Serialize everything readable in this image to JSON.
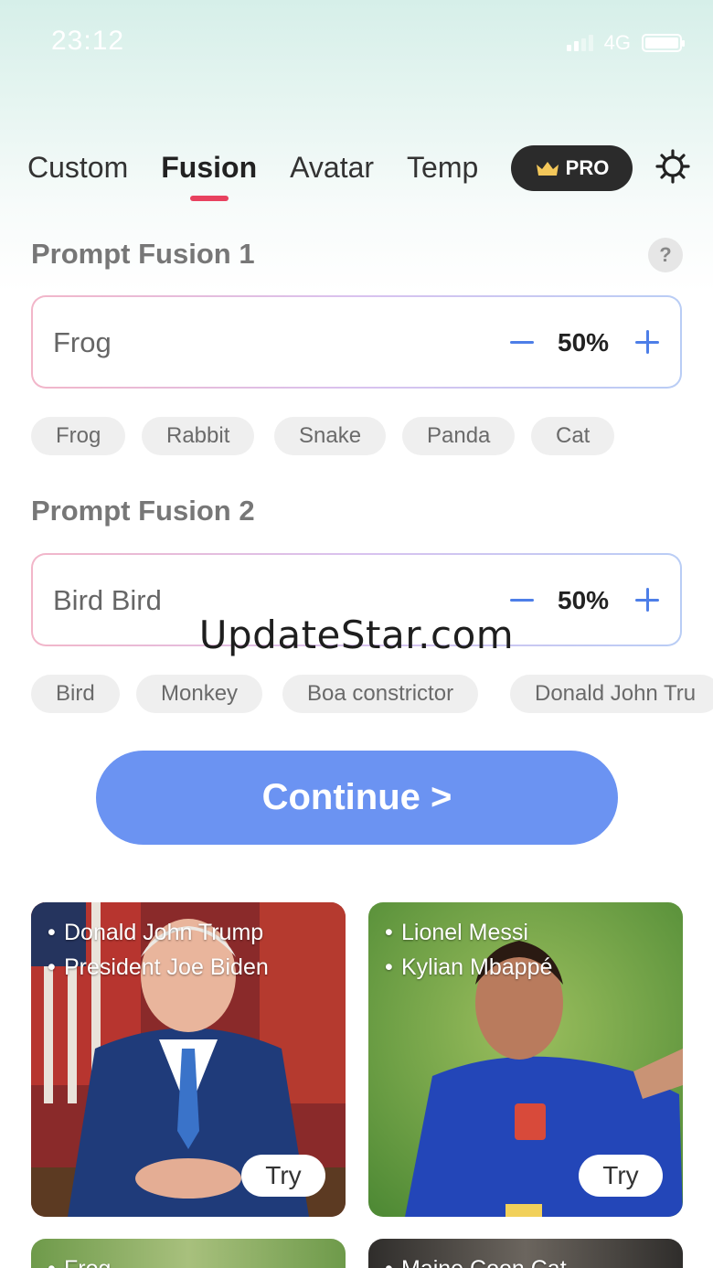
{
  "status_bar": {
    "time": "23:12",
    "network": "4G"
  },
  "tabs": [
    {
      "label": "Custom",
      "active": false
    },
    {
      "label": "Fusion",
      "active": true
    },
    {
      "label": "Avatar",
      "active": false
    },
    {
      "label": "Temp",
      "active": false
    }
  ],
  "header": {
    "pro_label": "PRO",
    "accent_color": "#e8415f"
  },
  "fusion1": {
    "title": "Prompt Fusion 1",
    "help": "?",
    "value": "Frog",
    "percent": "50%",
    "suggestions": [
      "Frog",
      "Rabbit",
      "Snake",
      "Panda",
      "Cat"
    ]
  },
  "fusion2": {
    "title": "Prompt Fusion 2",
    "value": "Bird  Bird",
    "percent": "50%",
    "suggestions": [
      "Bird",
      "Monkey",
      "Boa constrictor",
      "Donald John Tru"
    ]
  },
  "watermark": "UpdateStar.com",
  "continue_label": "Continue >",
  "continue_color": "#6b93f2",
  "cards": [
    {
      "lines": [
        "Donald John Trump",
        "President Joe Biden"
      ],
      "try_label": "Try"
    },
    {
      "lines": [
        "Lionel Messi",
        "Kylian Mbappé"
      ],
      "try_label": "Try"
    },
    {
      "lines": [
        "Frog"
      ]
    },
    {
      "lines": [
        "Maine Coon Cat"
      ]
    }
  ]
}
